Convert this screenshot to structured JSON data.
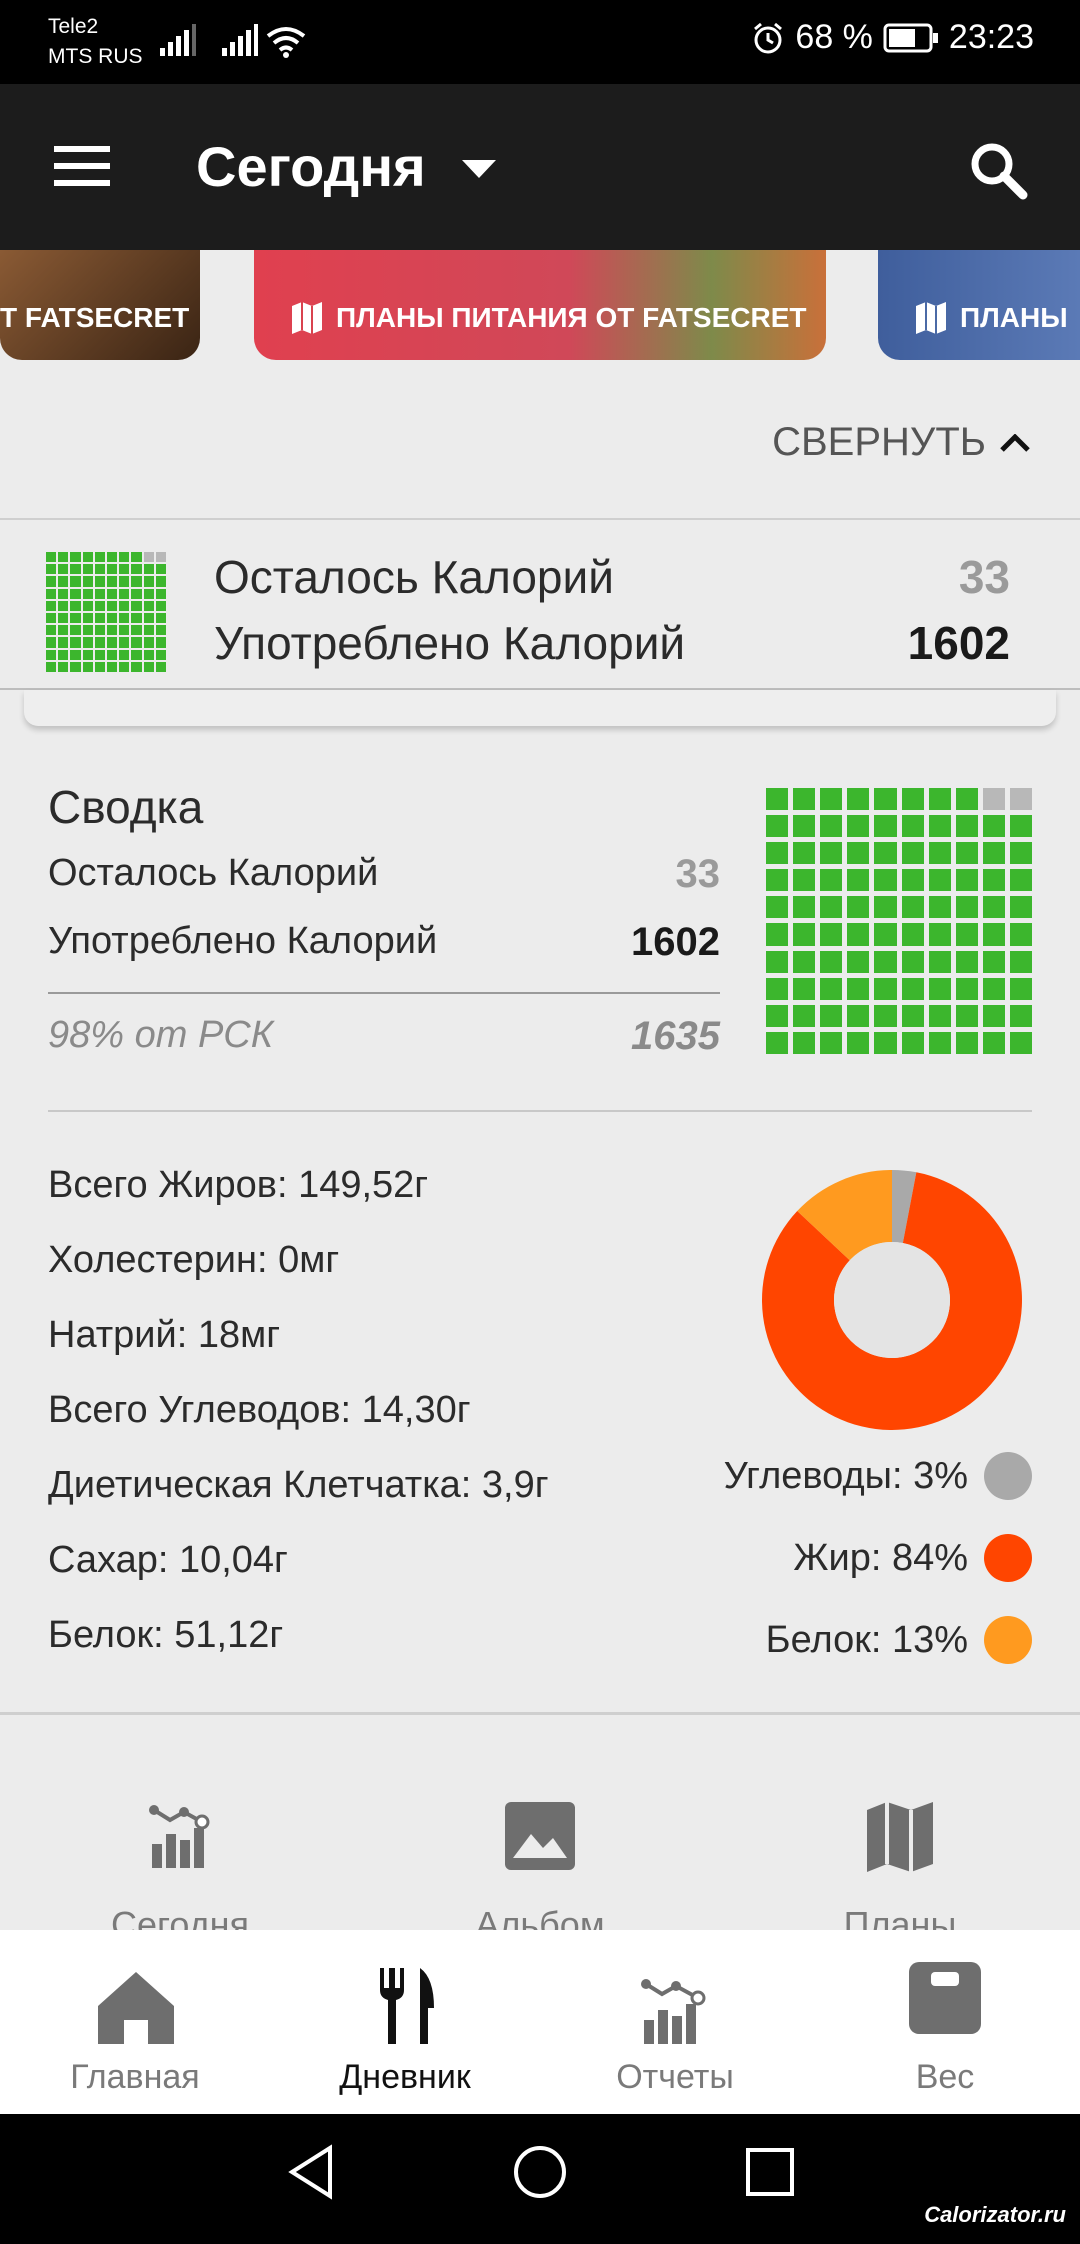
{
  "status_bar": {
    "carrier1": "Tele2",
    "carrier2": "MTS RUS",
    "battery": "68 %",
    "time": "23:23"
  },
  "toolbar": {
    "title": "Сегодня",
    "menu_icon": "menu-icon",
    "dropdown_icon": "dropdown-arrow-icon",
    "search_icon": "search-icon"
  },
  "banners": [
    {
      "label": "T FATSECRET",
      "color": "#5a3a20"
    },
    {
      "label": "ПЛАНЫ ПИТАНИЯ ОТ FATSECRET",
      "color": "#d9434f"
    },
    {
      "label": "ПЛАНЫ",
      "color": "#4b6aa6"
    }
  ],
  "collapse": {
    "label": "СВЕРНУТЬ"
  },
  "calories": {
    "remaining_label": "Осталось Калорий",
    "remaining_value": "33",
    "consumed_label": "Употреблено Калорий",
    "consumed_value": "1602"
  },
  "summary": {
    "title": "Сводка",
    "remaining_label": "Осталось Калорий",
    "remaining_value": "33",
    "consumed_label": "Употреблено Калорий",
    "consumed_value": "1602",
    "percent_label": "98% от РСК",
    "rsk_value": "1635"
  },
  "waffle": {
    "filled": 98,
    "total": 100
  },
  "nutrients": [
    "Всего Жиров: 149,52г",
    "Холестерин: 0мг",
    "Натрий: 18мг",
    "Всего Углеводов: 14,30г",
    "Диетическая Клетчатка: 3,9г",
    "Сахар: 10,04г",
    "Белок: 51,12г"
  ],
  "chart_data": {
    "type": "pie",
    "categories": [
      "Углеводы",
      "Жир",
      "Белок"
    ],
    "values": [
      3,
      84,
      13
    ],
    "colors": [
      "#a9a9a9",
      "#ff4500",
      "#ff9a1f"
    ],
    "legend": [
      "Углеводы: 3%",
      "Жир: 84%",
      "Белок: 13%"
    ]
  },
  "quick_actions": [
    {
      "label": "Сегодня",
      "icon": "chart-icon"
    },
    {
      "label": "Альбом",
      "icon": "image-icon"
    },
    {
      "label": "Планы",
      "icon": "map-icon"
    }
  ],
  "bottom_nav": [
    {
      "label": "Главная",
      "icon": "home-icon"
    },
    {
      "label": "Дневник",
      "icon": "fork-knife-icon"
    },
    {
      "label": "Отчеты",
      "icon": "chart-icon"
    },
    {
      "label": "Вес",
      "icon": "scale-icon"
    }
  ],
  "watermark": "Calorizator.ru"
}
